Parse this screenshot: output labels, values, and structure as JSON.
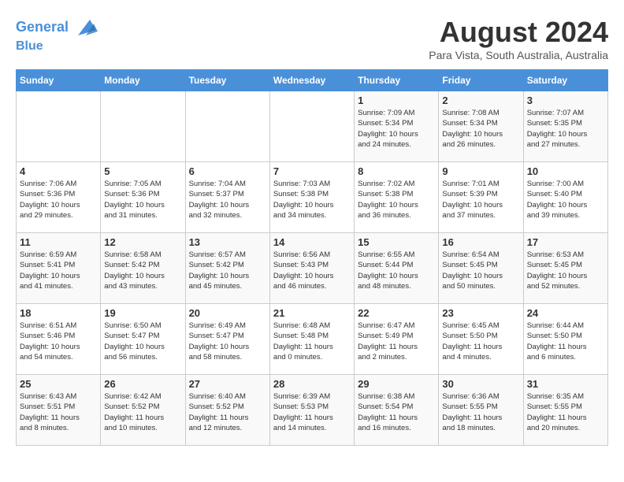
{
  "header": {
    "logo_line1": "General",
    "logo_line2": "Blue",
    "month": "August 2024",
    "location": "Para Vista, South Australia, Australia"
  },
  "weekdays": [
    "Sunday",
    "Monday",
    "Tuesday",
    "Wednesday",
    "Thursday",
    "Friday",
    "Saturday"
  ],
  "weeks": [
    [
      {
        "day": "",
        "info": ""
      },
      {
        "day": "",
        "info": ""
      },
      {
        "day": "",
        "info": ""
      },
      {
        "day": "",
        "info": ""
      },
      {
        "day": "1",
        "info": "Sunrise: 7:09 AM\nSunset: 5:34 PM\nDaylight: 10 hours\nand 24 minutes."
      },
      {
        "day": "2",
        "info": "Sunrise: 7:08 AM\nSunset: 5:34 PM\nDaylight: 10 hours\nand 26 minutes."
      },
      {
        "day": "3",
        "info": "Sunrise: 7:07 AM\nSunset: 5:35 PM\nDaylight: 10 hours\nand 27 minutes."
      }
    ],
    [
      {
        "day": "4",
        "info": "Sunrise: 7:06 AM\nSunset: 5:36 PM\nDaylight: 10 hours\nand 29 minutes."
      },
      {
        "day": "5",
        "info": "Sunrise: 7:05 AM\nSunset: 5:36 PM\nDaylight: 10 hours\nand 31 minutes."
      },
      {
        "day": "6",
        "info": "Sunrise: 7:04 AM\nSunset: 5:37 PM\nDaylight: 10 hours\nand 32 minutes."
      },
      {
        "day": "7",
        "info": "Sunrise: 7:03 AM\nSunset: 5:38 PM\nDaylight: 10 hours\nand 34 minutes."
      },
      {
        "day": "8",
        "info": "Sunrise: 7:02 AM\nSunset: 5:38 PM\nDaylight: 10 hours\nand 36 minutes."
      },
      {
        "day": "9",
        "info": "Sunrise: 7:01 AM\nSunset: 5:39 PM\nDaylight: 10 hours\nand 37 minutes."
      },
      {
        "day": "10",
        "info": "Sunrise: 7:00 AM\nSunset: 5:40 PM\nDaylight: 10 hours\nand 39 minutes."
      }
    ],
    [
      {
        "day": "11",
        "info": "Sunrise: 6:59 AM\nSunset: 5:41 PM\nDaylight: 10 hours\nand 41 minutes."
      },
      {
        "day": "12",
        "info": "Sunrise: 6:58 AM\nSunset: 5:42 PM\nDaylight: 10 hours\nand 43 minutes."
      },
      {
        "day": "13",
        "info": "Sunrise: 6:57 AM\nSunset: 5:42 PM\nDaylight: 10 hours\nand 45 minutes."
      },
      {
        "day": "14",
        "info": "Sunrise: 6:56 AM\nSunset: 5:43 PM\nDaylight: 10 hours\nand 46 minutes."
      },
      {
        "day": "15",
        "info": "Sunrise: 6:55 AM\nSunset: 5:44 PM\nDaylight: 10 hours\nand 48 minutes."
      },
      {
        "day": "16",
        "info": "Sunrise: 6:54 AM\nSunset: 5:45 PM\nDaylight: 10 hours\nand 50 minutes."
      },
      {
        "day": "17",
        "info": "Sunrise: 6:53 AM\nSunset: 5:45 PM\nDaylight: 10 hours\nand 52 minutes."
      }
    ],
    [
      {
        "day": "18",
        "info": "Sunrise: 6:51 AM\nSunset: 5:46 PM\nDaylight: 10 hours\nand 54 minutes."
      },
      {
        "day": "19",
        "info": "Sunrise: 6:50 AM\nSunset: 5:47 PM\nDaylight: 10 hours\nand 56 minutes."
      },
      {
        "day": "20",
        "info": "Sunrise: 6:49 AM\nSunset: 5:47 PM\nDaylight: 10 hours\nand 58 minutes."
      },
      {
        "day": "21",
        "info": "Sunrise: 6:48 AM\nSunset: 5:48 PM\nDaylight: 11 hours\nand 0 minutes."
      },
      {
        "day": "22",
        "info": "Sunrise: 6:47 AM\nSunset: 5:49 PM\nDaylight: 11 hours\nand 2 minutes."
      },
      {
        "day": "23",
        "info": "Sunrise: 6:45 AM\nSunset: 5:50 PM\nDaylight: 11 hours\nand 4 minutes."
      },
      {
        "day": "24",
        "info": "Sunrise: 6:44 AM\nSunset: 5:50 PM\nDaylight: 11 hours\nand 6 minutes."
      }
    ],
    [
      {
        "day": "25",
        "info": "Sunrise: 6:43 AM\nSunset: 5:51 PM\nDaylight: 11 hours\nand 8 minutes."
      },
      {
        "day": "26",
        "info": "Sunrise: 6:42 AM\nSunset: 5:52 PM\nDaylight: 11 hours\nand 10 minutes."
      },
      {
        "day": "27",
        "info": "Sunrise: 6:40 AM\nSunset: 5:52 PM\nDaylight: 11 hours\nand 12 minutes."
      },
      {
        "day": "28",
        "info": "Sunrise: 6:39 AM\nSunset: 5:53 PM\nDaylight: 11 hours\nand 14 minutes."
      },
      {
        "day": "29",
        "info": "Sunrise: 6:38 AM\nSunset: 5:54 PM\nDaylight: 11 hours\nand 16 minutes."
      },
      {
        "day": "30",
        "info": "Sunrise: 6:36 AM\nSunset: 5:55 PM\nDaylight: 11 hours\nand 18 minutes."
      },
      {
        "day": "31",
        "info": "Sunrise: 6:35 AM\nSunset: 5:55 PM\nDaylight: 11 hours\nand 20 minutes."
      }
    ]
  ]
}
